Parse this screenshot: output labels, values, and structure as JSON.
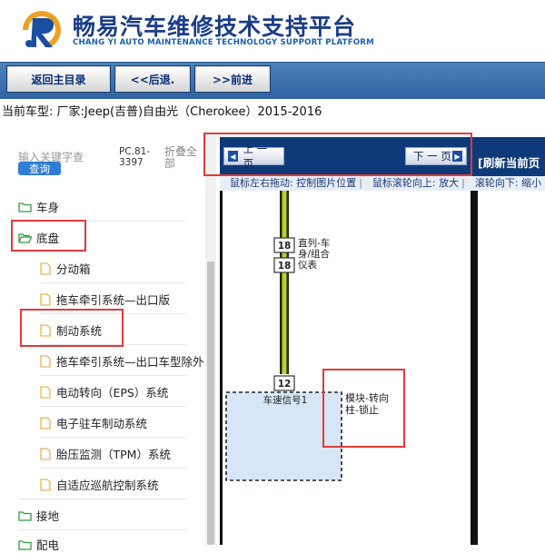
{
  "header": {
    "title": "畅易汽车维修技术支持平台",
    "subtitle": "CHANG YI AUTO MAINTENANCE TECHNOLOGY SUPPORT PLATFORM"
  },
  "nav": {
    "home_label": "返回主目录",
    "back_label": "<<后退.",
    "forward_label": ">>前进"
  },
  "current_model": "当前车型:  厂家:Jeep(吉普)自由光（Cherokee）2015-2016",
  "sidebar": {
    "search_hint": "输入关键字查",
    "query_label": "查询",
    "pc_code": "PC.81-3397",
    "collapse_label": "折叠全部",
    "items": [
      {
        "label": "车身",
        "type": "folder"
      },
      {
        "label": "底盘",
        "type": "folder-open"
      },
      {
        "label": "分动箱",
        "type": "file"
      },
      {
        "label": "拖车牵引系统—出口版",
        "type": "file"
      },
      {
        "label": "制动系统",
        "type": "file"
      },
      {
        "label": "拖车牵引系统—出口车型除外",
        "type": "file"
      },
      {
        "label": "电动转向（EPS）系统",
        "type": "file"
      },
      {
        "label": "电子驻车制动系统",
        "type": "file"
      },
      {
        "label": "胎压监测（TPM）系统",
        "type": "file"
      },
      {
        "label": "自适应巡航控制系统",
        "type": "file"
      },
      {
        "label": "接地",
        "type": "folder"
      },
      {
        "label": "配电",
        "type": "folder"
      }
    ]
  },
  "viewer": {
    "prev_label": "上 一 页",
    "next_label": "下 一 页",
    "refresh_label": "[刷新当前页",
    "hints": [
      "鼠标左右拖动: 控制图片位置",
      "鼠标滚轮向上: 放大",
      "滚轮向下: 缩小"
    ]
  },
  "diagram": {
    "pin_18_a": "18",
    "pin_18_b": "18",
    "label_direct": "直列-车身/组合仪表",
    "pin_12": "12",
    "signal_label": "车速信号1",
    "module_label": "模块-转向柱-锁止",
    "wire_color": "#b9d32a"
  },
  "colors": {
    "brand_blue": "#1a3c8a",
    "nav_blue": "#3a6fae",
    "viewer_bar": "#0e3a7a",
    "highlight_red": "#e03b3b",
    "module_fill": "#d6e6f6",
    "folder_green": "#2e9e3f",
    "file_orange": "#e8a23a"
  },
  "icons": {
    "logo": "cr-logo-icon",
    "folder": "folder-icon",
    "file": "document-icon",
    "prev_arrow": "arrow-left-icon",
    "next_arrow": "arrow-right-icon"
  }
}
